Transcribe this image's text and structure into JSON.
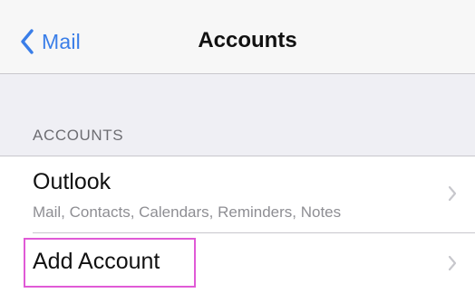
{
  "navbar": {
    "back_label": "Mail",
    "title": "Accounts"
  },
  "section": {
    "header": "ACCOUNTS"
  },
  "accounts": [
    {
      "name": "Outlook",
      "details": "Mail, Contacts, Calendars, Reminders, Notes"
    }
  ],
  "add_account": {
    "label": "Add Account"
  },
  "colors": {
    "accent": "#3a7ee8",
    "highlight": "#e05ad6",
    "background": "#efeff4"
  },
  "icons": {
    "back": "chevron-left-icon",
    "disclosure": "chevron-right-icon"
  }
}
